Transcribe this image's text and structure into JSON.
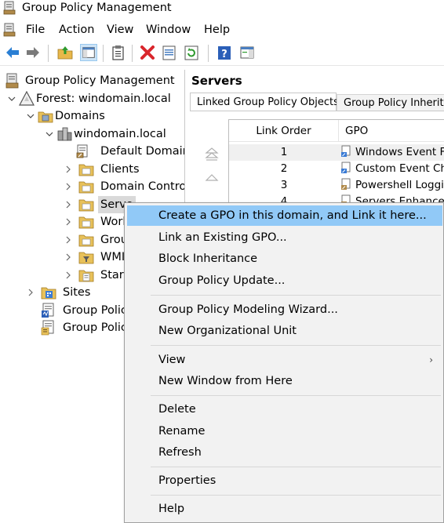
{
  "window": {
    "title": "Group Policy Management",
    "icon": "gpmc-app-icon"
  },
  "menubar": {
    "items": [
      "File",
      "Action",
      "View",
      "Window",
      "Help"
    ]
  },
  "toolbar": {
    "buttons": [
      "back-icon",
      "forward-icon",
      "up-folder-icon",
      "show-hide-tree-icon",
      "clipboard-icon",
      "delete-icon",
      "properties-icon",
      "refresh-icon",
      "help-icon",
      "action-pane-icon"
    ]
  },
  "tree": {
    "root": "Group Policy Management",
    "forest": "Forest: windomain.local",
    "domains": "Domains",
    "domain": "windomain.local",
    "children": [
      "Default Domain",
      "Clients",
      "Domain Control",
      "Serve",
      "Work",
      "Grou",
      "WMI",
      "Start"
    ],
    "sites": "Sites",
    "modeling": "Group Policy",
    "results": "Group Policy"
  },
  "rightpane": {
    "title": "Servers",
    "tabs": [
      "Linked Group Policy Objects",
      "Group Policy Inheritanc"
    ],
    "columns": [
      "Link Order",
      "GPO"
    ],
    "rows": [
      {
        "order": "1",
        "gpo": "Windows Event Fo"
      },
      {
        "order": "2",
        "gpo": "Custom Event Cha"
      },
      {
        "order": "3",
        "gpo": "Powershell Loggin"
      },
      {
        "order": "4",
        "gpo": "Servers Enhanced"
      }
    ]
  },
  "context_menu": {
    "items": [
      "Create a GPO in this domain, and Link it here...",
      "Link an Existing GPO...",
      "Block Inheritance",
      "Group Policy Update...",
      "Group Policy Modeling Wizard...",
      "New Organizational Unit",
      "View",
      "New Window from Here",
      "Delete",
      "Rename",
      "Refresh",
      "Properties",
      "Help"
    ],
    "submenu_arrow": "›"
  },
  "colors": {
    "highlight": "#91c9f7",
    "menu_bg": "#f2f2f2",
    "selection": "#d9d9d9"
  }
}
